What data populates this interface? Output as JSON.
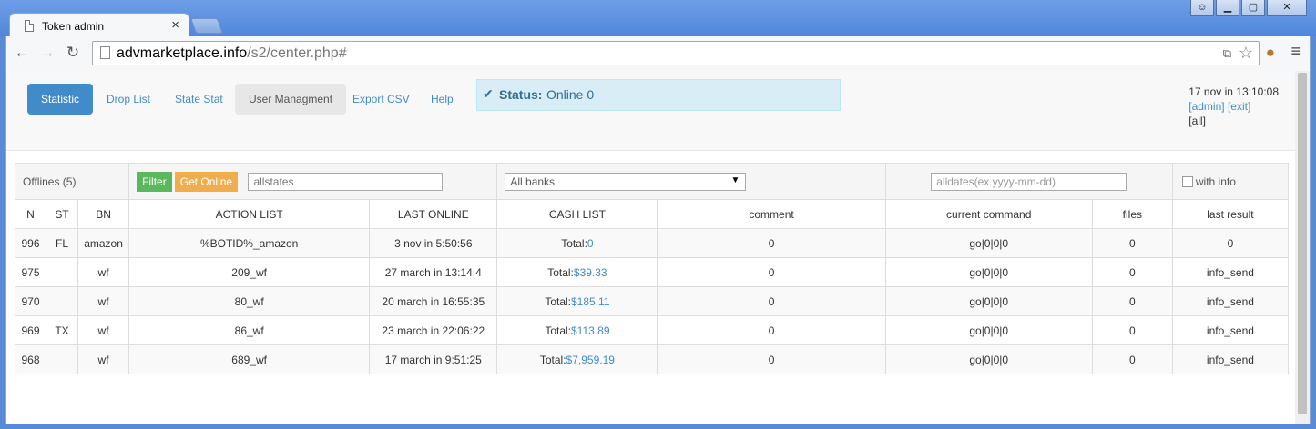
{
  "browser": {
    "tab_title": "Token admin",
    "url_domain": "advmarketplace.info",
    "url_path": "/s2/center.php#"
  },
  "nav": {
    "items": [
      {
        "label": "Statistic",
        "active": true
      },
      {
        "label": "Drop List"
      },
      {
        "label": "State Stat"
      },
      {
        "label": "User Managment"
      },
      {
        "label": "Export CSV"
      },
      {
        "label": "Help"
      }
    ]
  },
  "status": {
    "label": "Status:",
    "value": "Online 0"
  },
  "user": {
    "datetime": "17 nov in 13:10:08",
    "admin": "[admin]",
    "exit": "[exit]",
    "all": "[all]"
  },
  "filters": {
    "offlines": "Offlines (5)",
    "filter_btn": "Filter",
    "get_online_btn": "Get Online",
    "states_value": "allstates",
    "banks_value": "All banks",
    "dates_placeholder": "alldates(ex.yyyy-mm-dd)",
    "with_info": "with info"
  },
  "table": {
    "headers": [
      "N",
      "ST",
      "BN",
      "ACTION LIST",
      "LAST ONLINE",
      "CASH LIST",
      "comment",
      "current command",
      "files",
      "last result"
    ],
    "rows": [
      {
        "n": "996",
        "st": "FL",
        "bn": "amazon",
        "action": "%BOTID%_amazon",
        "last_online": "3 nov in 5:50:56",
        "cash_prefix": "Total:",
        "cash": "0",
        "comment": "0",
        "command": "go|0|0|0",
        "files": "0",
        "result": "0"
      },
      {
        "n": "975",
        "st": "",
        "bn": "wf",
        "action": "209_wf",
        "last_online": "27 march in 13:14:4",
        "cash_prefix": "Total:",
        "cash": "$39.33",
        "comment": "0",
        "command": "go|0|0|0",
        "files": "0",
        "result": "info_send"
      },
      {
        "n": "970",
        "st": "",
        "bn": "wf",
        "action": "80_wf",
        "last_online": "20 march in 16:55:35",
        "cash_prefix": "Total:",
        "cash": "$185.11",
        "comment": "0",
        "command": "go|0|0|0",
        "files": "0",
        "result": "info_send"
      },
      {
        "n": "969",
        "st": "TX",
        "bn": "wf",
        "action": "86_wf",
        "last_online": "23 march in 22:06:22",
        "cash_prefix": "Total:",
        "cash": "$113.89",
        "comment": "0",
        "command": "go|0|0|0",
        "files": "0",
        "result": "info_send"
      },
      {
        "n": "968",
        "st": "",
        "bn": "wf",
        "action": "689_wf",
        "last_online": "17 march in 9:51:25",
        "cash_prefix": "Total:",
        "cash": "$7,959.19",
        "comment": "0",
        "command": "go|0|0|0",
        "files": "0",
        "result": "info_send"
      }
    ]
  },
  "colors": {
    "link": "#428bca",
    "orange": "#e8994a",
    "primary": "#428bca",
    "success": "#5cb85c",
    "warning": "#f0ad4e"
  }
}
